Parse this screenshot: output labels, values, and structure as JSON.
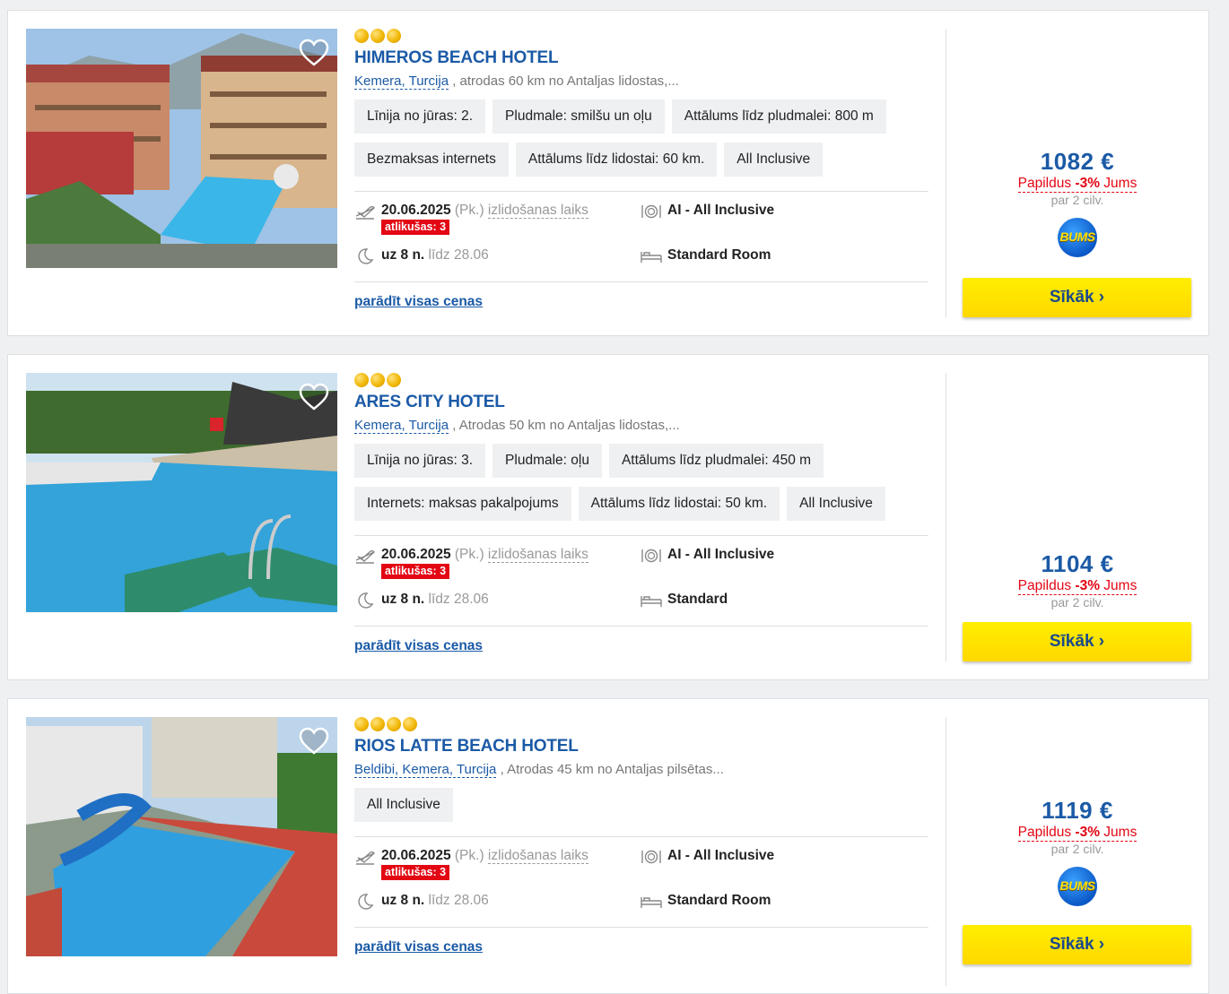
{
  "labels": {
    "departure_time": "izlidošanas laiks",
    "show_all_prices": "parādīt visas cenas",
    "details_button": "Sīkāk ›",
    "extra_prefix": "Papildus ",
    "extra_discount": "-3%",
    "extra_suffix": " Jums",
    "per_people": "par 2 cilv."
  },
  "colors": {
    "brand_blue": "#1b5aa6",
    "accent_red": "#e30613",
    "button_yellow": "#ffe600",
    "star_gold": "#f0b400"
  },
  "hotels": [
    {
      "stars": 3,
      "name": "HIMEROS BEACH HOTEL",
      "location": "Kemera, Turcija",
      "location_note": " , atrodas 60 km no Antaljas lidostas,...",
      "tags": [
        "Līnija no jūras: 2.",
        "Pludmale: smilšu un oļu",
        "Attālums līdz pludmalei: 800 m",
        "Bezmaksas internets",
        "Attālums līdz lidostai: 60 km.",
        "All Inclusive"
      ],
      "date": "20.06.2025",
      "weekday": "(Pk.)",
      "remaining": "atlikušas: 3",
      "nights": "uz 8 n.",
      "until": "līdz 28.06",
      "meal": "AI - All Inclusive",
      "room": "Standard Room",
      "price": "1082 €",
      "has_bums": true,
      "bums_label": "BUMS"
    },
    {
      "stars": 3,
      "name": "ARES CITY HOTEL",
      "location": "Kemera, Turcija",
      "location_note": " , Atrodas 50 km no Antaljas lidostas,...",
      "tags": [
        "Līnija no jūras: 3.",
        "Pludmale: oļu",
        "Attālums līdz pludmalei: 450 m",
        "Internets: maksas pakalpojums",
        "Attālums līdz lidostai: 50 km.",
        "All Inclusive"
      ],
      "date": "20.06.2025",
      "weekday": "(Pk.)",
      "remaining": "atlikušas: 3",
      "nights": "uz 8 n.",
      "until": "līdz 28.06",
      "meal": "AI - All Inclusive",
      "room": "Standard",
      "price": "1104 €",
      "has_bums": false
    },
    {
      "stars": 4,
      "name": "RIOS LATTE BEACH HOTEL",
      "location": "Beldibi, Kemera, Turcija",
      "location_note": " , Atrodas 45 km no Antaljas pilsētas...",
      "tags": [
        "All Inclusive"
      ],
      "date": "20.06.2025",
      "weekday": "(Pk.)",
      "remaining": "atlikušas: 3",
      "nights": "uz 8 n.",
      "until": "līdz 28.06",
      "meal": "AI - All Inclusive",
      "room": "Standard Room",
      "price": "1119 €",
      "has_bums": true,
      "bums_label": "BUMS"
    }
  ]
}
